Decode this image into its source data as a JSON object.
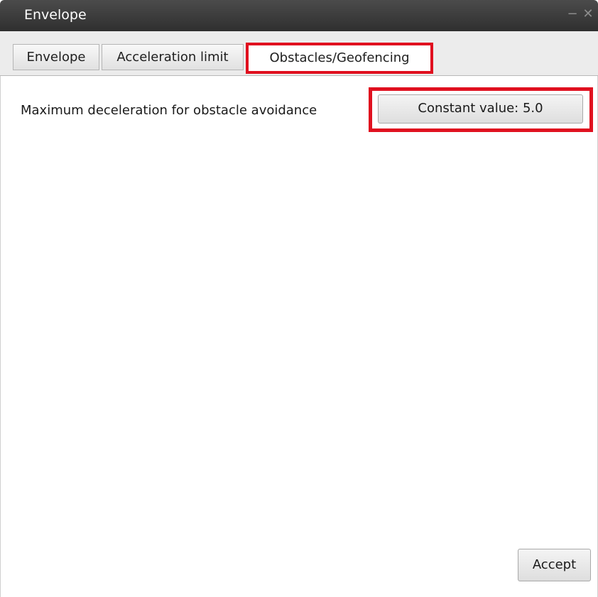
{
  "window": {
    "title": "Envelope",
    "minimize_glyph": "−",
    "close_glyph": "✕"
  },
  "tabs": [
    {
      "label": "Envelope",
      "selected": false
    },
    {
      "label": "Acceleration limit",
      "selected": false
    },
    {
      "label": "Obstacles/Geofencing",
      "selected": true
    }
  ],
  "main": {
    "field_label": "Maximum deceleration for obstacle avoidance",
    "value_button_label": "Constant value: 5.0",
    "accept_label": "Accept"
  },
  "colors": {
    "highlight": "#e0101f",
    "titlebar": "#3a3a3a"
  },
  "icons": {
    "minimize": "minimize-icon",
    "close": "close-icon"
  }
}
